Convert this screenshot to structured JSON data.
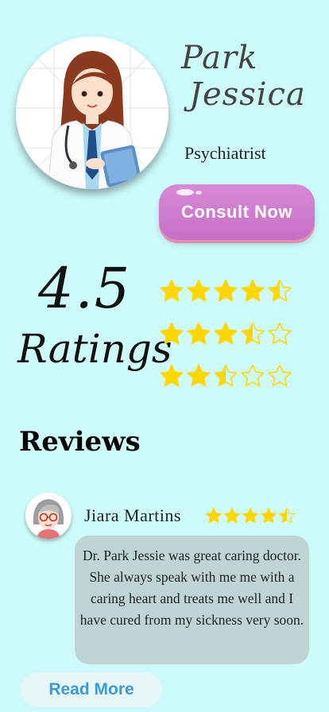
{
  "doctor": {
    "first_name": "Park",
    "last_name": "Jessica",
    "specialty": "Psychiatrist"
  },
  "consult_button": {
    "label": "Consult Now"
  },
  "rating": {
    "value": "4.5",
    "label": "Ratings",
    "rows": [
      4.5,
      3.5,
      2.5
    ]
  },
  "reviews": {
    "heading": "Reviews",
    "items": [
      {
        "name": "Jiara Martins",
        "stars": 4.5,
        "text": "Dr. Park Jessie was great caring doctor. She always speak with me me with a caring heart and treats me well and I have cured from my sickness very soon."
      }
    ],
    "read_more_label": "Read More"
  },
  "colors": {
    "background": "#cdfbfb",
    "star": "#ffd600",
    "button": "#c670c6",
    "card": "#bfd4d4",
    "link": "#3a9ad6"
  }
}
